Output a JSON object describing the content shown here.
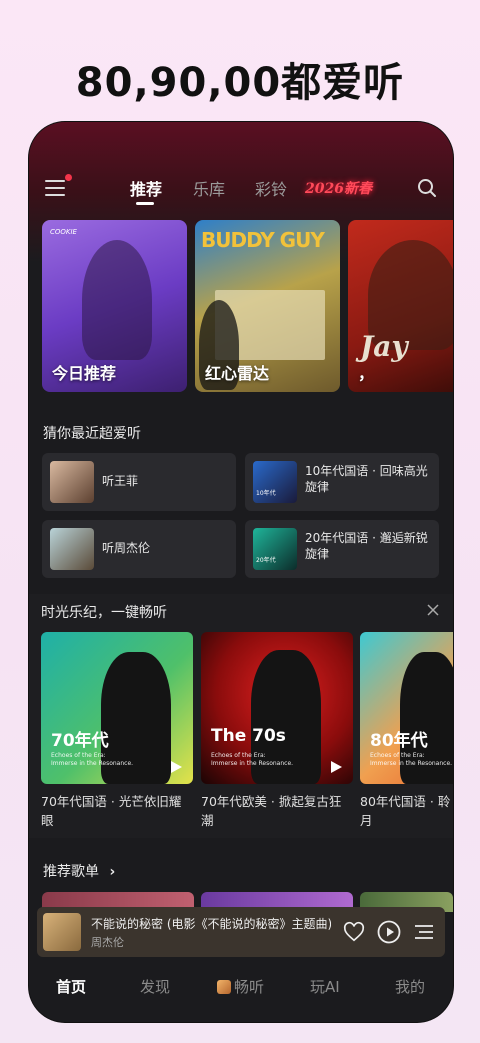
{
  "headline": "80,90,00都爱听",
  "top_tabs": [
    {
      "label": "推荐",
      "active": true
    },
    {
      "label": "乐库",
      "active": false
    },
    {
      "label": "彩铃",
      "active": false
    }
  ],
  "top_tab_special": "2026新春",
  "hero_cards": [
    {
      "label": "今日推荐",
      "art_text": "COOKIE"
    },
    {
      "label": "红心雷达",
      "art_text": "BUDDY GUY"
    },
    {
      "label": "，",
      "art_text": "Jay"
    }
  ],
  "guess": {
    "title": "猜你最近超爱听",
    "items": [
      {
        "label": "听王菲"
      },
      {
        "label": "10年代国语 · 回味高光旋律",
        "thumb_text": "10年代"
      },
      {
        "label": "听周杰伦"
      },
      {
        "label": "20年代国语 · 邂逅新锐旋律",
        "thumb_text": "20年代"
      }
    ]
  },
  "era": {
    "title": "时光乐纪，一键畅听",
    "cards": [
      {
        "title": "70年代",
        "sub1": "Echoes of the Era:",
        "sub2": "Immerse in the Resonance.",
        "caption": "70年代国语 · 光芒依旧耀眼",
        "color": "#1fa89a"
      },
      {
        "title": "The 70s",
        "sub1": "Echoes of the Era:",
        "sub2": "Immerse in the Resonance.",
        "caption": "70年代欧美 · 掀起复古狂潮",
        "color": "#d01a1a"
      },
      {
        "title": "80年代",
        "sub1": "Echoes of the Era:",
        "sub2": "Immerse in the Resonance.",
        "caption": "80年代国语 · 聆月",
        "color": "#2bb0c8"
      }
    ]
  },
  "playlists": {
    "title": "推荐歌单"
  },
  "player": {
    "title": "不能说的秘密 (电影《不能说的秘密》主题曲)",
    "artist": "周杰伦"
  },
  "bottom_nav": [
    {
      "label": "首页",
      "active": true
    },
    {
      "label": "发现",
      "active": false
    },
    {
      "label": "畅听",
      "active": false
    },
    {
      "label": "玩AI",
      "active": false
    },
    {
      "label": "我的",
      "active": false
    }
  ],
  "colors": {
    "accent_red": "#f2344a",
    "background": "#1b1b1e"
  }
}
